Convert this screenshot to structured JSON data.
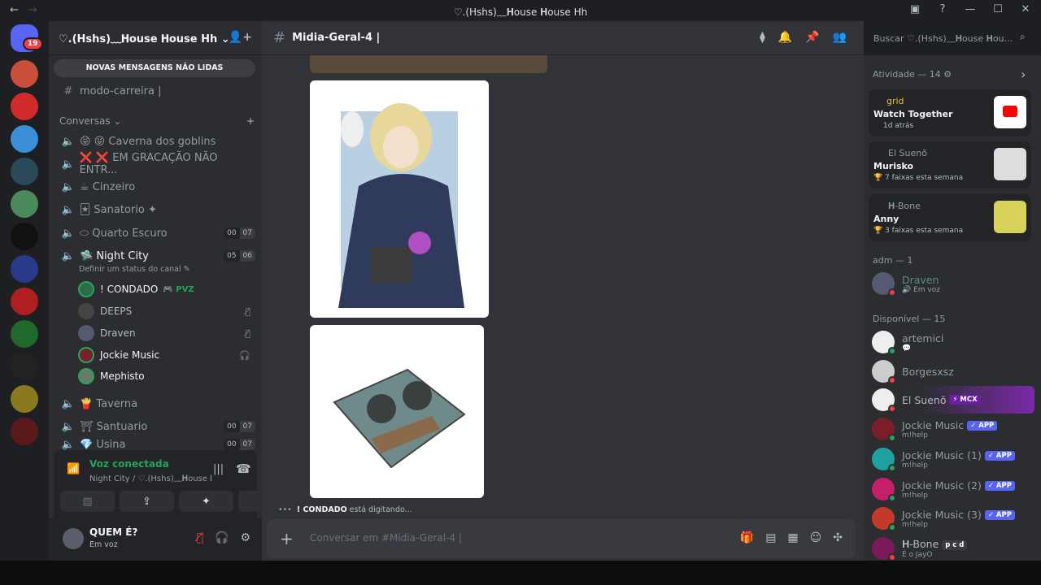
{
  "window": {
    "title": "♡.(Hshs)﹏𝐇ouse 𝐇ouse Hh"
  },
  "guilds": {
    "badge": "19"
  },
  "sidebar": {
    "server_name": "♡.(Hshs)﹏𝐇ouse 𝐇ouse Hh ⌄",
    "unread_banner": "NOVAS MENSAGENS NÃO LIDAS",
    "top_channel": "modo-carreira |",
    "category": "Conversas ⌄",
    "channels": [
      {
        "name": "😝 😝 Caverna dos goblins",
        "limit": [
          "",
          ""
        ]
      },
      {
        "name": "❌ ❌ EM GRACAÇÃO NÃO ENTR...",
        "limit": [
          "",
          ""
        ]
      },
      {
        "name": "☕ Cinzeiro",
        "limit": [
          "",
          ""
        ]
      },
      {
        "name": "🃏 Sanatorio ✦",
        "limit": [
          "",
          ""
        ]
      },
      {
        "name": "⬭ Quarto Escuro",
        "limit": [
          "00",
          "07"
        ]
      },
      {
        "name": "🛸 Night City",
        "limit": [
          "05",
          "06"
        ]
      }
    ],
    "channel_status_hint": "Definir um status do canal ✎",
    "voice_users": [
      {
        "name": "! CONDADO",
        "extra": "🎮 PVZ"
      },
      {
        "name": "DEEPS",
        "extra": ""
      },
      {
        "name": "Draven",
        "extra": ""
      },
      {
        "name": "Jockie Music",
        "extra": ""
      },
      {
        "name": "Mephisto",
        "extra": ""
      }
    ],
    "more_channels": [
      {
        "name": "🍟 Taverna",
        "limit": [
          "",
          ""
        ]
      },
      {
        "name": "⛩ Santuario",
        "limit": [
          "00",
          "07"
        ]
      },
      {
        "name": "💎 Usina",
        "limit": [
          "00",
          "07"
        ]
      }
    ],
    "voice_panel": {
      "status": "Voz conectada",
      "sub": "Night City / ♡.(Hshs)﹏𝐇ouse 𝐇o..."
    },
    "user": {
      "name": "QUEM É?",
      "status": "Em voz"
    }
  },
  "chat": {
    "channel_name": "Midia-Geral-4 |",
    "typing": {
      "who": "! CONDADO",
      "text": " está digitando..."
    },
    "composer_placeholder": "Conversar em #Midia-Geral-4 |"
  },
  "search": {
    "placeholder": "Buscar ♡.(Hshs)﹏𝐇ouse 𝐇ou..."
  },
  "members": {
    "activity_header": "Atividade — 14 ⚙",
    "activities": [
      {
        "user": "grid",
        "title": "Watch Together",
        "sub": "1d atrás"
      },
      {
        "user": "El Suenõ",
        "title": "Murisko",
        "sub": "🏆 7 faixas esta semana"
      },
      {
        "user": "𝐇-Bone",
        "title": "Anny",
        "sub": "🏆 3 faixas esta semana"
      }
    ],
    "adm_header": "adm — 1",
    "adm": [
      {
        "name": "Draven",
        "sub": "🔊 Em voz"
      }
    ],
    "available_header": "Disponível — 15",
    "available": [
      {
        "name": "artemici",
        "sub": "💬",
        "tag": ""
      },
      {
        "name": "Borgesxsz",
        "sub": "",
        "tag": ""
      },
      {
        "name": "El Suenõ",
        "sub": "",
        "tag": "⚡ MCX"
      },
      {
        "name": "Jockie Music",
        "sub": "m!help",
        "tag": "✓ APP"
      },
      {
        "name": "Jockie Music (1)",
        "sub": "m!help",
        "tag": "✓ APP"
      },
      {
        "name": "Jockie Music (2)",
        "sub": "m!help",
        "tag": "✓ APP"
      },
      {
        "name": "Jockie Music (3)",
        "sub": "m!help",
        "tag": "✓ APP"
      },
      {
        "name": "𝐇-Bone",
        "sub": "É o JayO",
        "tag": "p c d"
      }
    ]
  }
}
